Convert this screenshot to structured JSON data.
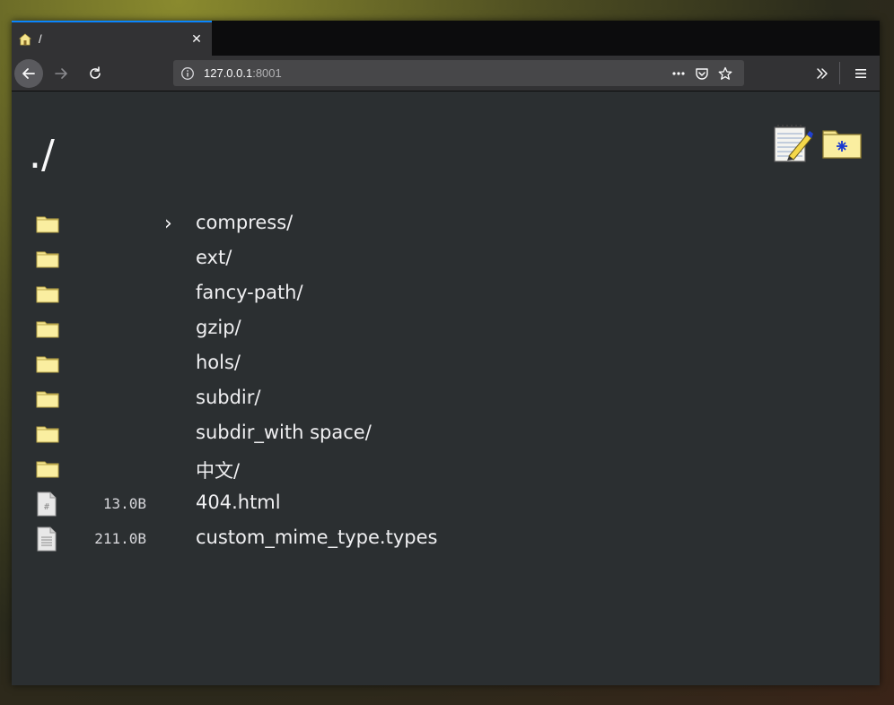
{
  "browser": {
    "tab": {
      "title": "/"
    },
    "url": {
      "host": "127.0.0.1",
      "port": ":8001"
    }
  },
  "page": {
    "title": "./",
    "entries": [
      {
        "type": "dir",
        "name": "compress/",
        "size": "",
        "arrow": "›"
      },
      {
        "type": "dir",
        "name": "ext/",
        "size": ""
      },
      {
        "type": "dir",
        "name": "fancy-path/",
        "size": ""
      },
      {
        "type": "dir",
        "name": "gzip/",
        "size": ""
      },
      {
        "type": "dir",
        "name": "hols/",
        "size": ""
      },
      {
        "type": "dir",
        "name": "subdir/",
        "size": ""
      },
      {
        "type": "dir",
        "name": "subdir_with space/",
        "size": ""
      },
      {
        "type": "dir",
        "name": "中文/",
        "size": ""
      },
      {
        "type": "file",
        "name": "404.html",
        "size": "13.0B",
        "icon": "html-file-icon"
      },
      {
        "type": "file",
        "name": "custom_mime_type.types",
        "size": "211.0B",
        "icon": "text-file-icon"
      }
    ]
  },
  "colors": {
    "background": "#2b2f31",
    "folder": "#f5e58f",
    "accent": "#0a84ff"
  }
}
